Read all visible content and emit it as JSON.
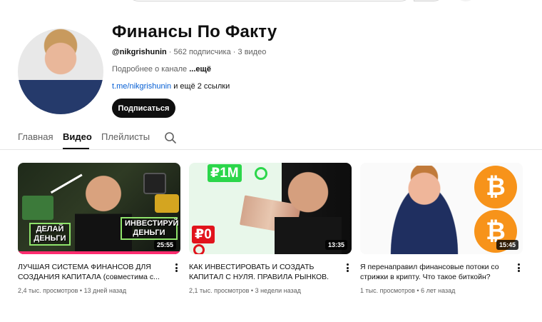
{
  "channel": {
    "title": "Финансы По Факту",
    "handle": "@nikgrishunin",
    "subscribers": "562 подписчика",
    "videos_count": "3 видео",
    "description": "Подробнее о канале",
    "more": "...ещё",
    "link": "t.me/nikgrishunin",
    "more_links": "и ещё 2 ссылки",
    "subscribe_label": "Подписаться"
  },
  "tabs": [
    {
      "label": "Главная"
    },
    {
      "label": "Видео"
    },
    {
      "label": "Плейлисты"
    }
  ],
  "videos": [
    {
      "title": "ЛУЧШАЯ СИСТЕМА ФИНАНСОВ ДЛЯ СОЗДАНИЯ КАПИТАЛА (совместима с...",
      "views": "2,4 тыс. просмотров",
      "age": "13 дней назад",
      "duration": "25:55",
      "thumb_text_left": "ДЕЛАЙ ДЕНЬГИ",
      "thumb_text_right": "ИНВЕСТИРУЙ ДЕНЬГИ"
    },
    {
      "title": "КАК ИНВЕСТИРОВАТЬ И СОЗДАТЬ КАПИТАЛ С НУЛЯ. ПРАВИЛА РЫНКОВ.",
      "views": "2,1 тыс. просмотров",
      "age": "3 недели назад",
      "duration": "13:35",
      "thumb_tag_top": "₽1M",
      "thumb_tag_bottom": "₽0"
    },
    {
      "title": "Я перенаправил финансовые потоки со стрижки в крипту. Что такое биткойн?",
      "views": "1 тыс. просмотров",
      "age": "6 лет назад",
      "duration": "15:45",
      "thumb_coin": "₿"
    }
  ],
  "icons": {
    "search": "search-icon",
    "more": "more-vert-icon"
  },
  "colors": {
    "subscribe_bg": "#0f0f0f",
    "link": "#065fd4",
    "bitcoin": "#f7931a"
  }
}
